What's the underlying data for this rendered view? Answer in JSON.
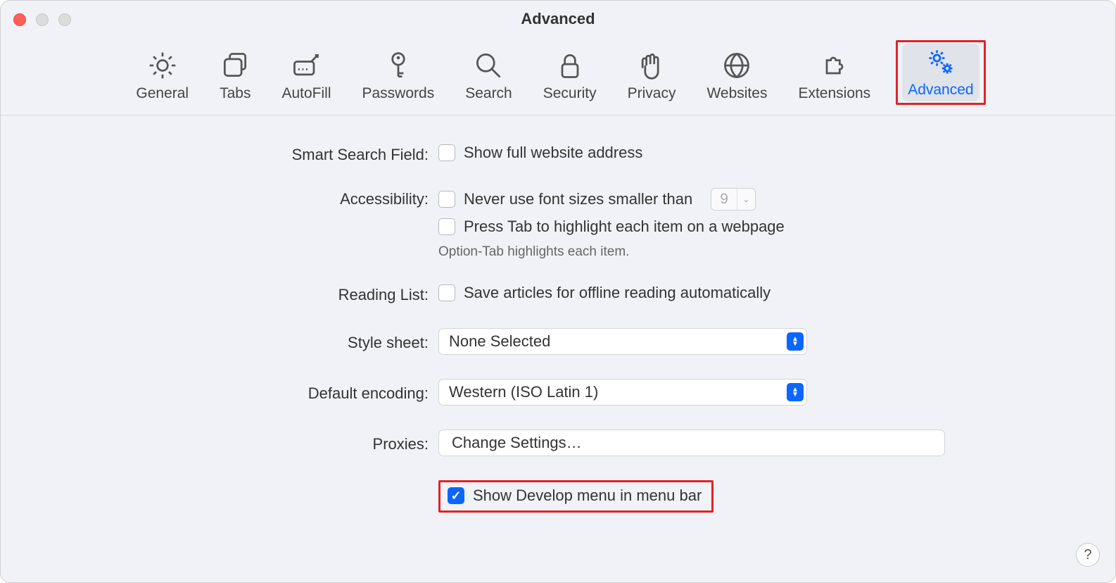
{
  "window": {
    "title": "Advanced"
  },
  "toolbar": {
    "items": [
      {
        "label": "General"
      },
      {
        "label": "Tabs"
      },
      {
        "label": "AutoFill"
      },
      {
        "label": "Passwords"
      },
      {
        "label": "Search"
      },
      {
        "label": "Security"
      },
      {
        "label": "Privacy"
      },
      {
        "label": "Websites"
      },
      {
        "label": "Extensions"
      },
      {
        "label": "Advanced"
      }
    ]
  },
  "sections": {
    "smartSearch": {
      "label": "Smart Search Field:",
      "opt1": "Show full website address"
    },
    "accessibility": {
      "label": "Accessibility:",
      "opt1": "Never use font sizes smaller than",
      "fontSize": "9",
      "opt2": "Press Tab to highlight each item on a webpage",
      "hint": "Option-Tab highlights each item."
    },
    "readingList": {
      "label": "Reading List:",
      "opt1": "Save articles for offline reading automatically"
    },
    "styleSheet": {
      "label": "Style sheet:",
      "value": "None Selected"
    },
    "encoding": {
      "label": "Default encoding:",
      "value": "Western (ISO Latin 1)"
    },
    "proxies": {
      "label": "Proxies:",
      "button": "Change Settings…"
    },
    "develop": {
      "label": "Show Develop menu in menu bar"
    }
  },
  "help": "?"
}
